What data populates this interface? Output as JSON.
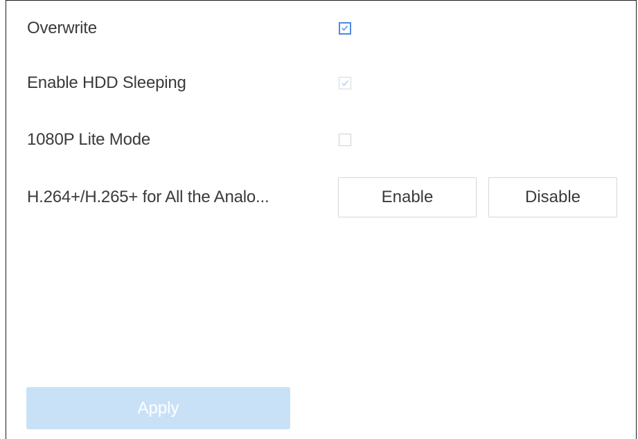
{
  "settings": {
    "overwrite": {
      "label": "Overwrite",
      "checked": true,
      "state": "enabled"
    },
    "hdd_sleeping": {
      "label": "Enable HDD Sleeping",
      "checked": true,
      "state": "disabled"
    },
    "lite_mode": {
      "label": "1080P Lite Mode",
      "checked": false,
      "state": "disabled"
    },
    "codec_plus": {
      "label": "H.264+/H.265+ for All the Analo...",
      "enable_label": "Enable",
      "disable_label": "Disable"
    }
  },
  "footer": {
    "apply_label": "Apply",
    "apply_state": "disabled"
  },
  "colors": {
    "accent": "#4a8ae0",
    "apply_disabled_bg": "#c9e1f7",
    "checkbox_border": "#cfcfcf"
  }
}
